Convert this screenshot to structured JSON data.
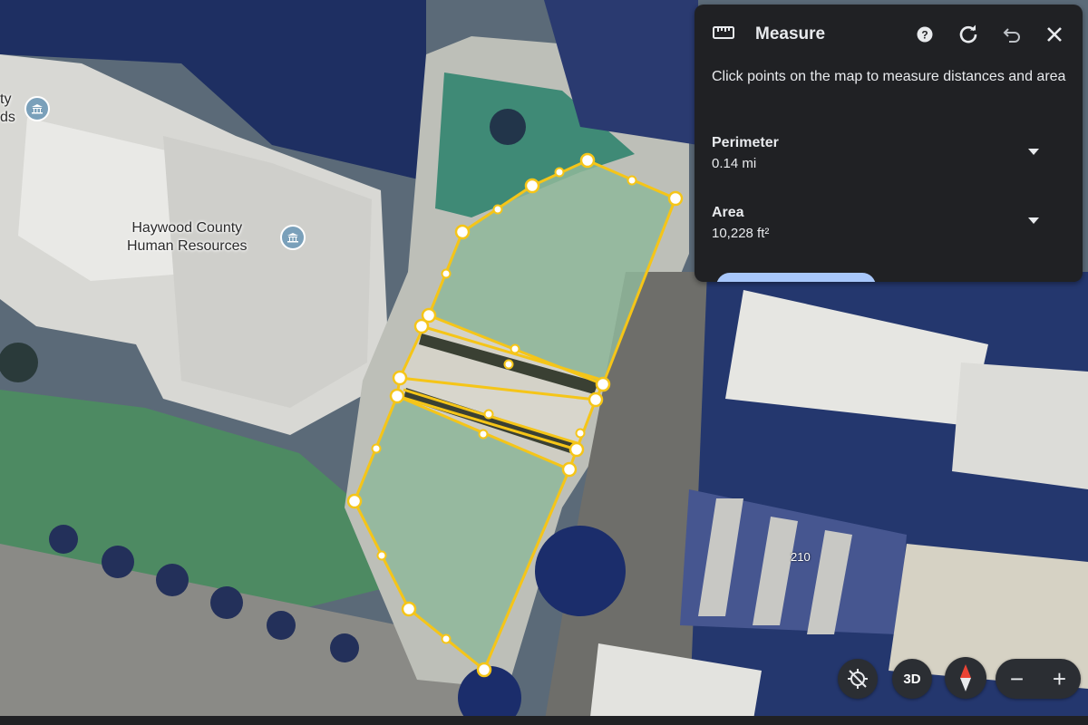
{
  "measure_panel": {
    "title": "Measure",
    "instructions": "Click points on the map to measure distances and area",
    "perimeter": {
      "label": "Perimeter",
      "value": "0.14 mi"
    },
    "area": {
      "label": "Area",
      "value": "10,228 ft²"
    }
  },
  "map": {
    "labels": {
      "hr_line1": "Haywood County",
      "hr_line2": "Human Resources",
      "edge_line1": "ty",
      "edge_line2": "ds",
      "building_number": "210"
    },
    "overlay_color": "#f5c518"
  },
  "controls": {
    "three_d_label": "3D",
    "zoom_out_label": "−",
    "zoom_in_label": "+"
  },
  "icons": {
    "ruler": "ruler-icon",
    "help": "help-icon",
    "refresh": "refresh-icon",
    "undo": "undo-icon",
    "close": "close-icon",
    "location_off": "location-off-icon",
    "compass": "compass-icon",
    "building": "building-icon"
  }
}
